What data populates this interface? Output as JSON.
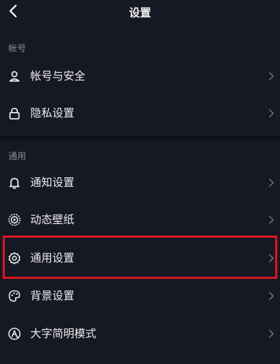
{
  "header": {
    "title": "设置",
    "back_icon": "chevron-left-icon"
  },
  "sections": [
    {
      "label": "帐号",
      "items": [
        {
          "label": "帐号与安全",
          "icon": "user-icon"
        },
        {
          "label": "隐私设置",
          "icon": "lock-icon"
        }
      ]
    },
    {
      "label": "通用",
      "items": [
        {
          "label": "通知设置",
          "icon": "bell-icon"
        },
        {
          "label": "动态壁纸",
          "icon": "dynamic-wallpaper-icon"
        },
        {
          "label": "通用设置",
          "icon": "gear-icon",
          "highlighted": true
        },
        {
          "label": "背景设置",
          "icon": "palette-icon"
        },
        {
          "label": "大字简明模式",
          "icon": "large-text-icon"
        }
      ]
    }
  ],
  "colors": {
    "background": "#161823",
    "text": "#ECECEE",
    "muted": "#8A8B91",
    "highlight": "#E0161F"
  }
}
